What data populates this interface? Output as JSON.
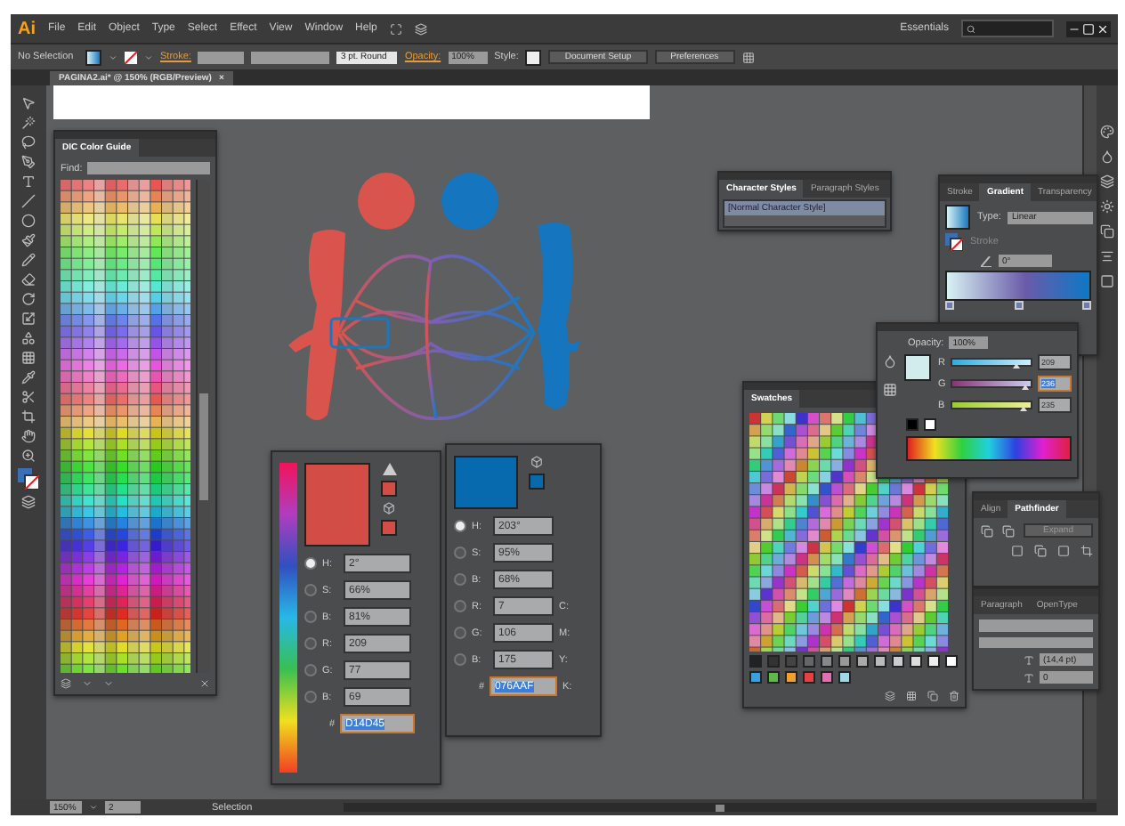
{
  "menu_bar": {
    "logo": "Ai",
    "items": [
      "File",
      "Edit",
      "Object",
      "Type",
      "Select",
      "Effect",
      "View",
      "Window",
      "Help"
    ],
    "workspace": "Essentials"
  },
  "control_bar": {
    "selection": "No Selection",
    "stroke_label": "Stroke:",
    "brush": "3 pt. Round",
    "opacity_label": "Opacity:",
    "opacity": "100%",
    "style_label": "Style:",
    "buttons": [
      "Document Setup",
      "Preferences"
    ]
  },
  "document_tab": {
    "title": "PAGINA2.ai* @ 150% (RGB/Preview)",
    "close": "×"
  },
  "color_guide": {
    "title": "DIC Color Guide",
    "find_label": "Find:"
  },
  "color_panels": [
    {
      "color": "#d14d45",
      "fields": [
        {
          "label": "H:",
          "value": "2°",
          "selected": true
        },
        {
          "label": "S:",
          "value": "66%",
          "selected": false
        },
        {
          "label": "B:",
          "value": "81%",
          "selected": false
        },
        {
          "label": "R:",
          "value": "209",
          "selected": false
        },
        {
          "label": "G:",
          "value": "77",
          "selected": false
        },
        {
          "label": "B:",
          "value": "69",
          "selected": false
        }
      ],
      "hex_label": "#",
      "hex": "D14D45"
    },
    {
      "color": "#076aaf",
      "fields": [
        {
          "label": "H:",
          "value": "203°",
          "selected": true
        },
        {
          "label": "S:",
          "value": "95%",
          "selected": false
        },
        {
          "label": "B:",
          "value": "68%",
          "selected": false
        },
        {
          "label": "R:",
          "value": "7",
          "selected": false
        },
        {
          "label": "G:",
          "value": "106",
          "selected": false
        },
        {
          "label": "B:",
          "value": "175",
          "selected": false
        }
      ],
      "hex_label": "#",
      "hex": "076AAF",
      "side_labels": [
        "C:",
        "M:",
        "Y:",
        "K:"
      ]
    }
  ],
  "character_styles": {
    "tabs": [
      {
        "label": "Character Styles",
        "selected": true
      },
      {
        "label": "Paragraph Styles",
        "selected": false
      }
    ],
    "items": [
      {
        "label": "[Normal Character Style]",
        "selected": true
      }
    ]
  },
  "gradient_panel": {
    "tabs": [
      {
        "label": "Stroke",
        "selected": false
      },
      {
        "label": "Gradient",
        "selected": true
      },
      {
        "label": "Transparency",
        "selected": false
      }
    ],
    "type_label": "Type:",
    "type": "Linear",
    "stroke_label": "Stroke",
    "angle": "0°"
  },
  "color_picker": {
    "opacity_label": "Opacity:",
    "opacity": "100%",
    "channels": [
      {
        "name": "R",
        "value": "209",
        "level": 0.82,
        "selected": false
      },
      {
        "name": "G",
        "value": "236",
        "level": 0.93,
        "selected": true
      },
      {
        "name": "B",
        "value": "235",
        "level": 0.92,
        "selected": false
      }
    ]
  },
  "swatches_panel": {
    "tabs": [
      {
        "label": "Swatches",
        "selected": true
      }
    ]
  },
  "pathfinder_panel": {
    "tabs": [
      {
        "label": "Align",
        "selected": false
      },
      {
        "label": "Pathfinder",
        "selected": true
      }
    ],
    "button": "Expand"
  },
  "character_panel": {
    "tabs": [
      {
        "label": "Paragraph",
        "selected": false
      },
      {
        "label": "OpenType",
        "selected": false
      }
    ],
    "fields": [
      "(14,4 pt)",
      "0"
    ]
  },
  "status_bar": {
    "zoom": "150%",
    "page": "2",
    "tool": "Selection"
  }
}
